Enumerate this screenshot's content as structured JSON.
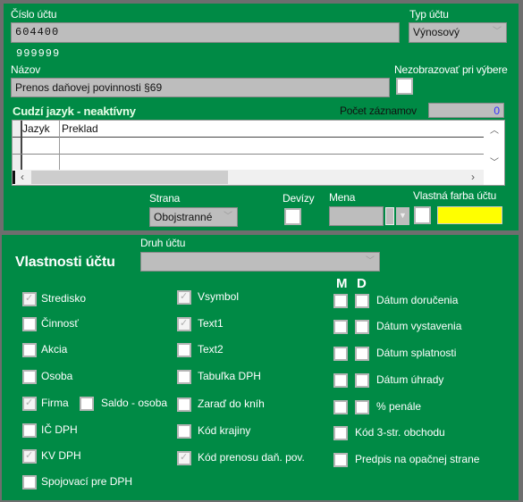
{
  "account": {
    "number_label": "Číslo účtu",
    "number_value": "604400",
    "sub_value": "999999",
    "type_label": "Typ účtu",
    "type_value": "Výnosový",
    "name_label": "Názov",
    "name_value": "Prenos daňovej povinnosti §69",
    "hide_label": "Nezobrazovať pri výbere",
    "hide_checked": false
  },
  "foreign": {
    "title": "Cudzí jazyk - neaktívny",
    "count_label": "Počet záznamov",
    "count_value": "0",
    "columns": [
      "Jazyk",
      "Preklad"
    ]
  },
  "options": {
    "side_label": "Strana",
    "side_value": "Obojstranné",
    "currency_flag_label": "Devízy",
    "currency_label": "Mena",
    "currency_value": "",
    "color_label": "Vlastná farba účtu",
    "color_value": "#ffff00"
  },
  "properties": {
    "title": "Vlastnosti účtu",
    "kind_label": "Druh účtu",
    "kind_value": "",
    "m_label": "M",
    "d_label": "D",
    "col1": [
      {
        "label": "Stredisko",
        "checked": true
      },
      {
        "label": "Činnosť",
        "checked": false
      },
      {
        "label": "Akcia",
        "checked": false
      },
      {
        "label": "Osoba",
        "checked": false
      },
      {
        "label": "Firma",
        "checked": true
      },
      {
        "label": "IČ DPH",
        "checked": false
      },
      {
        "label": "KV DPH",
        "checked": true
      },
      {
        "label": "Spojovací pre DPH",
        "checked": false
      }
    ],
    "saldo": {
      "label": "Saldo - osoba",
      "checked": false
    },
    "col2": [
      {
        "label": "Vsymbol",
        "checked": true
      },
      {
        "label": "Text1",
        "checked": true
      },
      {
        "label": "Text2",
        "checked": false
      },
      {
        "label": "Tabuľka DPH",
        "checked": false
      },
      {
        "label": "Zaraď do kníh",
        "checked": false
      },
      {
        "label": "Kód krajiny",
        "checked": false
      },
      {
        "label": "Kód prenosu daň. pov.",
        "checked": true
      }
    ],
    "col3_md": [
      {
        "label": "Dátum doručenia"
      },
      {
        "label": "Dátum vystavenia"
      },
      {
        "label": "Dátum splatnosti"
      },
      {
        "label": "Dátum úhrady"
      },
      {
        "label": "% penále"
      }
    ],
    "col3_single": [
      {
        "label": "Kód 3-str. obchodu",
        "checked": false
      },
      {
        "label": "Predpis na opačnej strane",
        "checked": false
      }
    ]
  }
}
